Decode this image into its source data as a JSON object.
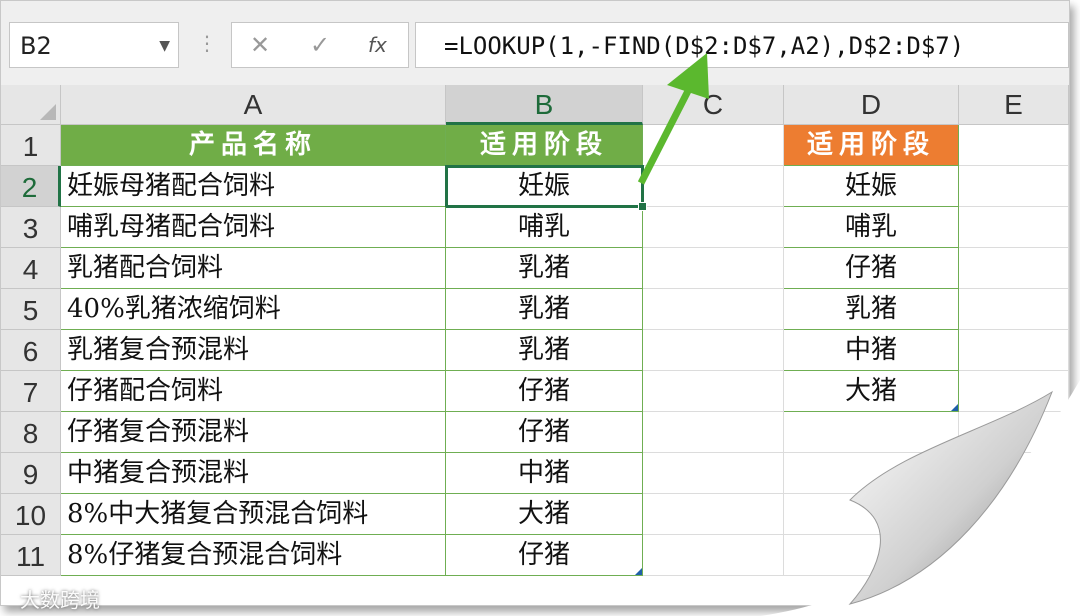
{
  "formula_bar": {
    "name_box": "B2",
    "cancel_icon": "✕",
    "enter_icon": "✓",
    "fx_label": "fx",
    "formula": "=LOOKUP(1,-FIND(D$2:D$7,A2),D$2:D$7)"
  },
  "columns": [
    "A",
    "B",
    "C",
    "D",
    "E"
  ],
  "rows": [
    "1",
    "2",
    "3",
    "4",
    "5",
    "6",
    "7",
    "8",
    "9",
    "10",
    "11"
  ],
  "table_left": {
    "header_a": "产品名称",
    "header_b": "适用阶段",
    "rows": [
      {
        "product": "妊娠母猪配合饲料",
        "stage": "妊娠"
      },
      {
        "product": "哺乳母猪配合饲料",
        "stage": "哺乳"
      },
      {
        "product": "乳猪配合饲料",
        "stage": "乳猪"
      },
      {
        "product": "40%乳猪浓缩饲料",
        "stage": "乳猪"
      },
      {
        "product": "乳猪复合预混料",
        "stage": "乳猪"
      },
      {
        "product": "仔猪配合饲料",
        "stage": "仔猪"
      },
      {
        "product": "仔猪复合预混料",
        "stage": "仔猪"
      },
      {
        "product": "中猪复合预混料",
        "stage": "中猪"
      },
      {
        "product": "8%中大猪复合预混合饲料",
        "stage": "大猪"
      },
      {
        "product": "8%仔猪复合预混合饲料",
        "stage": "仔猪"
      }
    ]
  },
  "table_right": {
    "header": "适用阶段",
    "items": [
      "妊娠",
      "哺乳",
      "仔猪",
      "乳猪",
      "中猪",
      "大猪"
    ]
  },
  "watermark": "大数跨境",
  "colors": {
    "header_green": "#70ad47",
    "header_orange": "#ed7d31",
    "arrow": "#5bb82e",
    "selection": "#217346"
  }
}
